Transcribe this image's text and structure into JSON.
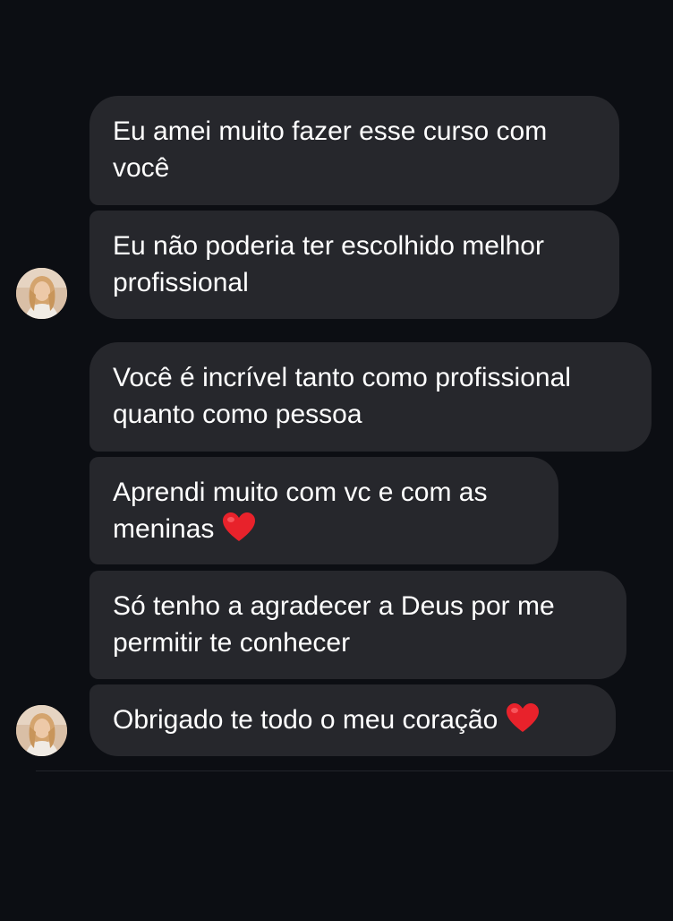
{
  "conversation": {
    "avatar_description": "profile-photo-avatar",
    "messages": [
      {
        "lines": [
          "Eu amei muito fazer esse curso com",
          "você"
        ],
        "emoji": ""
      },
      {
        "lines": [
          "Eu não poderia ter escolhido melhor",
          "profissional"
        ],
        "emoji": ""
      },
      {
        "lines": [
          "Você é incrível tanto como profissional",
          "quanto como pessoa"
        ],
        "emoji": ""
      },
      {
        "lines": [
          "Aprendi muito com vc e com as",
          "meninas"
        ],
        "emoji": "❤️"
      },
      {
        "lines": [
          "Só tenho a agradecer a Deus por me",
          "permitir te conhecer"
        ],
        "emoji": ""
      },
      {
        "lines": [
          "Obrigado te todo o meu coração"
        ],
        "emoji": "❤️"
      }
    ]
  },
  "colors": {
    "background": "#0c0e13",
    "bubble": "#26272c",
    "text": "#ffffff",
    "heart": "#e8222b"
  }
}
